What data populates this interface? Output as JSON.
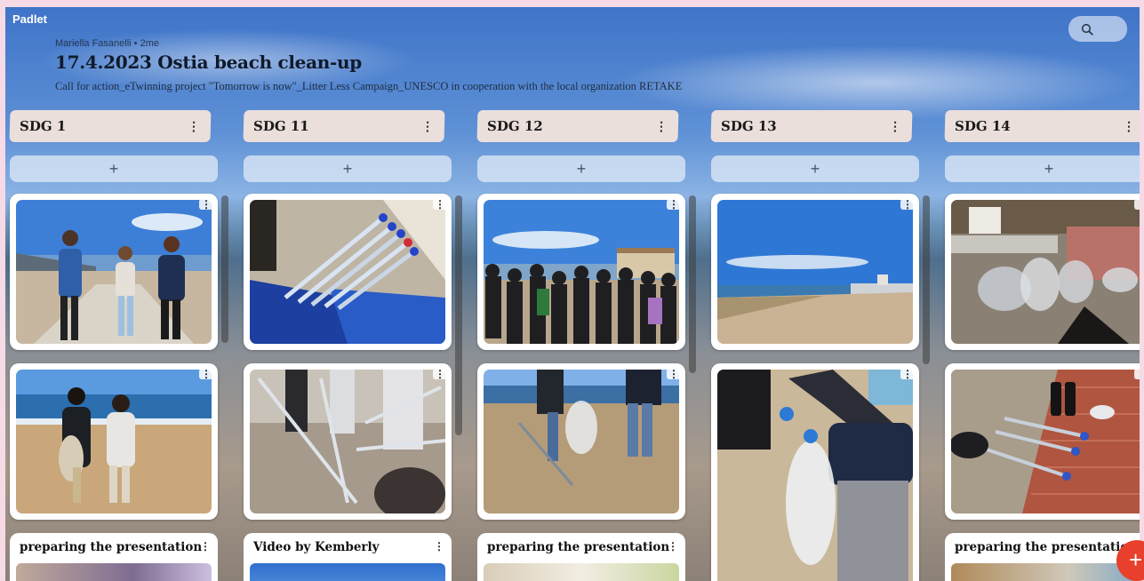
{
  "app": {
    "brand": "Padlet"
  },
  "header": {
    "author": "Mariella Fasanelli",
    "age": "2me",
    "title": "17.4.2023 Ostia beach clean-up",
    "subtitle": "Call for action_eTwinning project \"Tomorrow is now\"_Litter Less Campaign_UNESCO in cooperation with the local organization RETAKE"
  },
  "toolbar": {
    "search_icon": "search-icon"
  },
  "columns": [
    {
      "title": "SDG 1",
      "last_post": "preparing the presentation"
    },
    {
      "title": "SDG 11",
      "last_post": "Video by Kemberly"
    },
    {
      "title": "SDG 12",
      "last_post": "preparing the presentation"
    },
    {
      "title": "SDG 13",
      "last_post": ""
    },
    {
      "title": "SDG 14",
      "last_post": "preparing the presentation"
    }
  ],
  "symbols": {
    "add": "+",
    "kebab": "⋮",
    "meta_sep": "•"
  },
  "colors": {
    "fab": "#e8402c",
    "header_card": "#ebdfdc",
    "add_button": "#dce8f6"
  }
}
